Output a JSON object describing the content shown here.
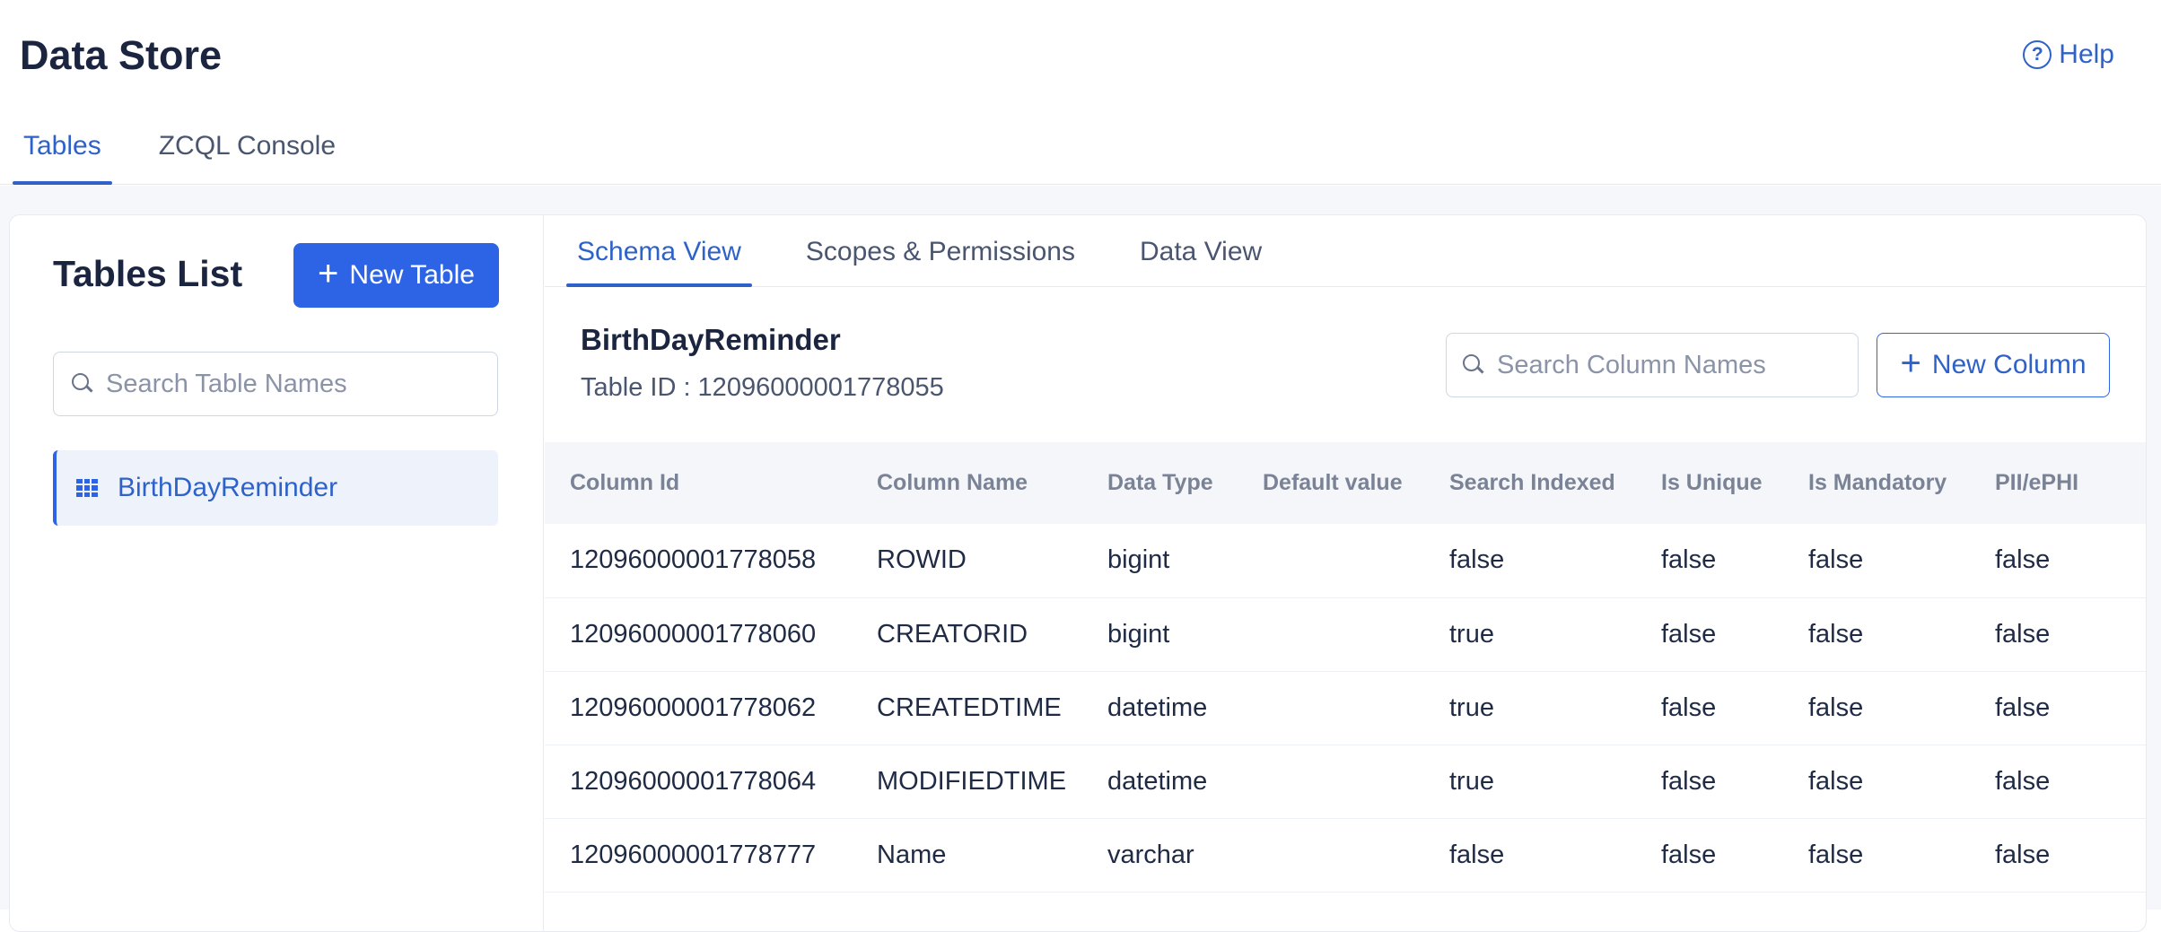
{
  "header": {
    "title": "Data Store",
    "help_label": "Help",
    "help_icon": "?",
    "tabs": [
      {
        "label": "Tables",
        "active": true
      },
      {
        "label": "ZCQL Console",
        "active": false
      }
    ]
  },
  "sidebar": {
    "title": "Tables List",
    "new_table_label": "New Table",
    "search_placeholder": "Search Table Names",
    "tables": [
      {
        "label": "BirthDayReminder",
        "selected": true
      }
    ]
  },
  "main": {
    "tabs": [
      {
        "label": "Schema View",
        "active": true
      },
      {
        "label": "Scopes & Permissions",
        "active": false
      },
      {
        "label": "Data View",
        "active": false
      }
    ],
    "table_name": "BirthDayReminder",
    "table_id_text": "Table ID : 12096000001778055",
    "column_search_placeholder": "Search Column Names",
    "new_column_label": "New Column",
    "columns": [
      "Column Id",
      "Column Name",
      "Data Type",
      "Default value",
      "Search Indexed",
      "Is Unique",
      "Is Mandatory",
      "PII/ePHI"
    ],
    "rows": [
      [
        "12096000001778058",
        "ROWID",
        "bigint",
        "",
        "false",
        "false",
        "false",
        "false"
      ],
      [
        "12096000001778060",
        "CREATORID",
        "bigint",
        "",
        "true",
        "false",
        "false",
        "false"
      ],
      [
        "12096000001778062",
        "CREATEDTIME",
        "datetime",
        "",
        "true",
        "false",
        "false",
        "false"
      ],
      [
        "12096000001778064",
        "MODIFIEDTIME",
        "datetime",
        "",
        "true",
        "false",
        "false",
        "false"
      ],
      [
        "12096000001778777",
        "Name",
        "varchar",
        "",
        "false",
        "false",
        "false",
        "false"
      ]
    ]
  },
  "colors": {
    "accent": "#2d64e6",
    "accent_text": "#2f62c9",
    "title_text": "#1b2540"
  }
}
